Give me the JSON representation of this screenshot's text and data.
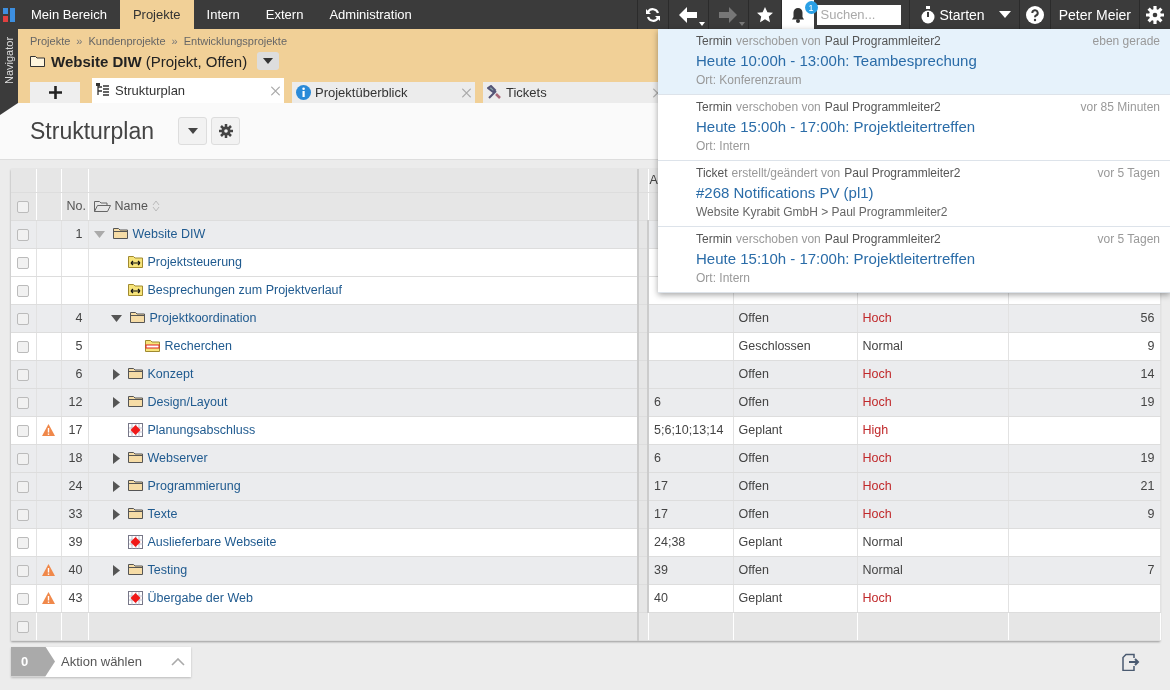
{
  "top_nav": {
    "tabs": [
      {
        "label": "Mein Bereich",
        "selected": false
      },
      {
        "label": "Projekte",
        "selected": true
      },
      {
        "label": "Intern",
        "selected": false
      },
      {
        "label": "Extern",
        "selected": false
      },
      {
        "label": "Administration",
        "selected": false
      }
    ]
  },
  "toolbar": {
    "forward_disabled": true,
    "notifications_open": true,
    "notification_count": "1",
    "search": {
      "placeholder": "Suchen..."
    },
    "start_label": "Starten",
    "user_name": "Peter Meier"
  },
  "navigator": {
    "label": "Navigator"
  },
  "header": {
    "breadcrumb": [
      {
        "label": "Projekte"
      },
      {
        "separator": "»",
        "label": "Kundenprojekte"
      },
      {
        "separator": "»",
        "label": "Entwicklungsprojekte"
      }
    ],
    "title": "**Website DIW** (Projekt, Offen)",
    "tabs": [
      {
        "kind": "tree",
        "label": "Strukturplan",
        "selected": true
      },
      {
        "kind": "info",
        "label": "Projektüberblick",
        "selected": false
      },
      {
        "kind": "tools",
        "label": "Tickets",
        "selected": false
      }
    ]
  },
  "page_title": "Strukturplan",
  "table": {
    "select_all_checked": false,
    "column_5_heading": "A",
    "columns": [
      {
        "label": "No."
      },
      {
        "label": "Name"
      }
    ],
    "rows": [
      {
        "checked": false,
        "warning": false,
        "no": "1",
        "kind": "folder",
        "name": "Website DIW",
        "expanded": true,
        "children": [
          {
            "checked": false,
            "warning": false,
            "kind": "link",
            "name": "Projektsteuerung"
          },
          {
            "checked": false,
            "warning": false,
            "kind": "link",
            "name": "Besprechungen zum Projektverlauf"
          },
          {
            "checked": false,
            "warning": false,
            "no": "4",
            "kind": "folder",
            "name": "Projektkoordination",
            "expanded": true,
            "column_6": "Offen",
            "column_7": "Hoch",
            "column_7_high": true,
            "column_8": "56",
            "children": [
              {
                "checked": false,
                "warning": false,
                "no": "5",
                "kind": "task",
                "name": "Recherchen",
                "column_6": "Geschlossen",
                "column_7": "Normal",
                "column_7_high": false,
                "column_8": "9"
              }
            ]
          },
          {
            "checked": false,
            "warning": false,
            "no": "6",
            "kind": "folder",
            "name": "Konzept",
            "expanded": false,
            "column_6": "Offen",
            "column_7": "Hoch",
            "column_7_high": true,
            "column_8": "14"
          },
          {
            "checked": false,
            "warning": false,
            "no": "12",
            "kind": "folder",
            "name": "Design/Layout",
            "expanded": false,
            "column_5": "6",
            "column_6": "Offen",
            "column_7": "Hoch",
            "column_7_high": true,
            "column_8": "19"
          },
          {
            "checked": false,
            "warning": true,
            "no": "17",
            "kind": "milestone",
            "name": "Planungsabschluss",
            "column_5": "5;6;10;13;14",
            "column_6": "Geplant",
            "column_7": "High",
            "column_7_high": true
          },
          {
            "checked": false,
            "warning": false,
            "no": "18",
            "kind": "folder",
            "name": "Webserver",
            "expanded": false,
            "column_5": "6",
            "column_6": "Offen",
            "column_7": "Hoch",
            "column_7_high": true,
            "column_8": "19"
          },
          {
            "checked": false,
            "warning": false,
            "no": "24",
            "kind": "folder",
            "name": "Programmierung",
            "expanded": false,
            "column_5": "17",
            "column_6": "Offen",
            "column_7": "Hoch",
            "column_7_high": true,
            "column_8": "21"
          },
          {
            "checked": false,
            "warning": false,
            "no": "33",
            "kind": "folder",
            "name": "Texte",
            "expanded": false,
            "column_5": "17",
            "column_6": "Offen",
            "column_7": "Hoch",
            "column_7_high": true,
            "column_8": "9"
          },
          {
            "checked": false,
            "warning": false,
            "no": "39",
            "kind": "milestone",
            "name": "Auslieferbare Webseite",
            "column_5": "24;38",
            "column_6": "Geplant",
            "column_7": "Normal",
            "column_7_high": false
          },
          {
            "checked": false,
            "warning": true,
            "no": "40",
            "kind": "folder",
            "name": "Testing",
            "expanded": false,
            "column_5": "39",
            "column_6": "Offen",
            "column_7": "Normal",
            "column_7_high": false,
            "column_8": "7"
          },
          {
            "checked": false,
            "warning": true,
            "no": "43",
            "kind": "milestone",
            "name": "Übergabe der Web",
            "column_5": "40",
            "column_6": "Geplant",
            "column_7": "Hoch",
            "column_7_high": true
          }
        ]
      }
    ],
    "footer_checked": false
  },
  "action_bar": {
    "count": "0",
    "label": "Aktion wählen"
  },
  "notifications": [
    {
      "selected": true,
      "type": "Termin",
      "action": "verschoben von",
      "author": "Paul Programmleiter2",
      "time": "eben gerade",
      "title": "Heute 10:00h - 13:00h: Teambesprechung",
      "detail": "Ort: Konferenzraum"
    },
    {
      "selected": false,
      "type": "Termin",
      "action": "verschoben von",
      "author": "Paul Programmleiter2",
      "time": "vor 85 Minuten",
      "title": "Heute 15:00h - 17:00h: Projektleitertreffen",
      "detail": "Ort: Intern"
    },
    {
      "selected": false,
      "type": "Ticket",
      "action": "erstellt/geändert von",
      "author": "Paul Programmleiter2",
      "time": "vor 5 Tagen",
      "title": "#268 Notifications PV (pl1)",
      "detail": "Website Kyrabit GmbH > Paul Programmleiter2"
    },
    {
      "selected": false,
      "type": "Termin",
      "action": "verschoben von",
      "author": "Paul Programmleiter2",
      "time": "vor 5 Tagen",
      "title": "Heute 15:10h - 17:00h: Projektleitertreffen",
      "detail": "Ort: Intern"
    }
  ]
}
